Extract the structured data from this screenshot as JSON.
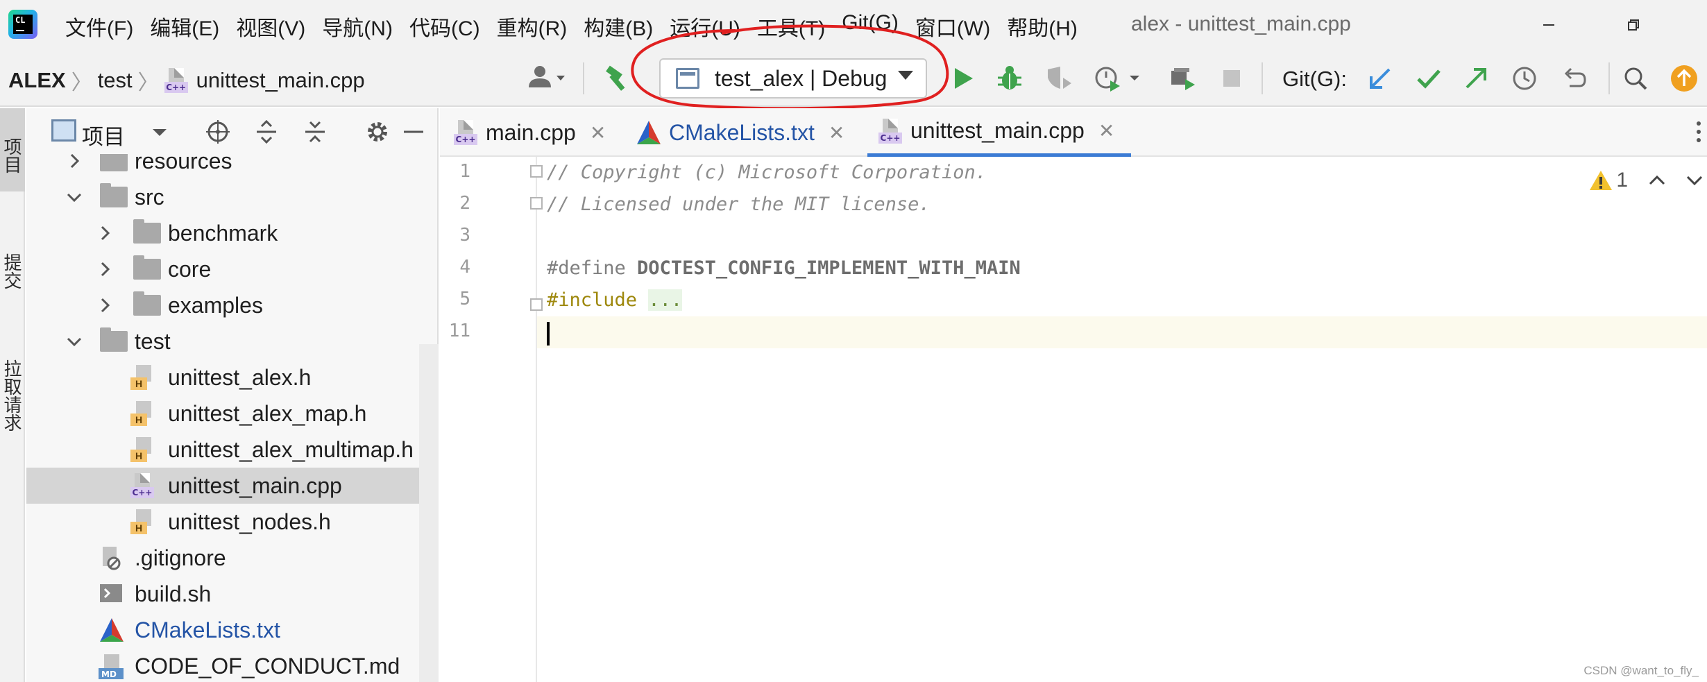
{
  "menubar": {
    "logo_text": "CL",
    "items": [
      "文件(F)",
      "编辑(E)",
      "视图(V)",
      "导航(N)",
      "代码(C)",
      "重构(R)",
      "构建(B)",
      "运行(U)",
      "工具(T)",
      "Git(G)",
      "窗口(W)",
      "帮助(H)"
    ],
    "window_title": "alex - unittest_main.cpp",
    "minimize_icon": "minimize-icon",
    "restore_icon": "restore-icon"
  },
  "toolbar": {
    "breadcrumb": [
      "ALEX",
      "test",
      "unittest_main.cpp"
    ],
    "run_config": "test_alex | Debug",
    "git_label": "Git(G):",
    "icons": [
      "user-icon",
      "build-hammer-icon",
      "run-icon",
      "debug-icon",
      "coverage-icon",
      "profiler-icon",
      "attach-icon",
      "stop-icon",
      "git-update-icon",
      "git-commit-icon",
      "git-push-icon",
      "history-icon",
      "rollback-icon",
      "search-icon",
      "ide-update-icon"
    ],
    "colors": {
      "run": "#3fa34d",
      "git_update": "#3a8ddb",
      "annotation": "#e02020",
      "ide_update": "#f0a020"
    }
  },
  "tool_strip": {
    "project": "项目",
    "commit": "提交",
    "pull_requests": "拉取请求"
  },
  "project_panel": {
    "title": "项目",
    "tree": [
      {
        "label": "resources",
        "type": "folder",
        "level": 1,
        "expanded": false
      },
      {
        "label": "src",
        "type": "folder",
        "level": 1,
        "expanded": true
      },
      {
        "label": "benchmark",
        "type": "folder",
        "level": 2,
        "expanded": false
      },
      {
        "label": "core",
        "type": "folder",
        "level": 2,
        "expanded": false
      },
      {
        "label": "examples",
        "type": "folder",
        "level": 2,
        "expanded": false
      },
      {
        "label": "test",
        "type": "folder",
        "level": 1,
        "expanded": true
      },
      {
        "label": "unittest_alex.h",
        "type": "h",
        "level": 2
      },
      {
        "label": "unittest_alex_map.h",
        "type": "h",
        "level": 2
      },
      {
        "label": "unittest_alex_multimap.h",
        "type": "h",
        "level": 2
      },
      {
        "label": "unittest_main.cpp",
        "type": "cpp",
        "level": 2,
        "selected": true
      },
      {
        "label": "unittest_nodes.h",
        "type": "h",
        "level": 2
      },
      {
        "label": ".gitignore",
        "type": "gitignore",
        "level": 1
      },
      {
        "label": "build.sh",
        "type": "sh",
        "level": 1
      },
      {
        "label": "CMakeLists.txt",
        "type": "cmake",
        "level": 1
      },
      {
        "label": "CODE_OF_CONDUCT.md",
        "type": "md",
        "level": 1
      }
    ]
  },
  "editor": {
    "tabs": [
      {
        "label": "main.cpp",
        "type": "cpp",
        "active": false
      },
      {
        "label": "CMakeLists.txt",
        "type": "cmake",
        "active": false
      },
      {
        "label": "unittest_main.cpp",
        "type": "cpp",
        "active": true
      }
    ],
    "line_numbers": [
      "1",
      "2",
      "3",
      "4",
      "5",
      "11"
    ],
    "code": {
      "line1": "// Copyright (c) Microsoft Corporation.",
      "line2": "// Licensed under the MIT license.",
      "line4_directive": "#define ",
      "line4_macro": "DOCTEST_CONFIG_IMPLEMENT_WITH_MAIN",
      "line5_directive": "#include ",
      "line5_folded": "..."
    },
    "inspection": {
      "warnings": "1"
    }
  },
  "watermark": "CSDN @want_to_fly_"
}
